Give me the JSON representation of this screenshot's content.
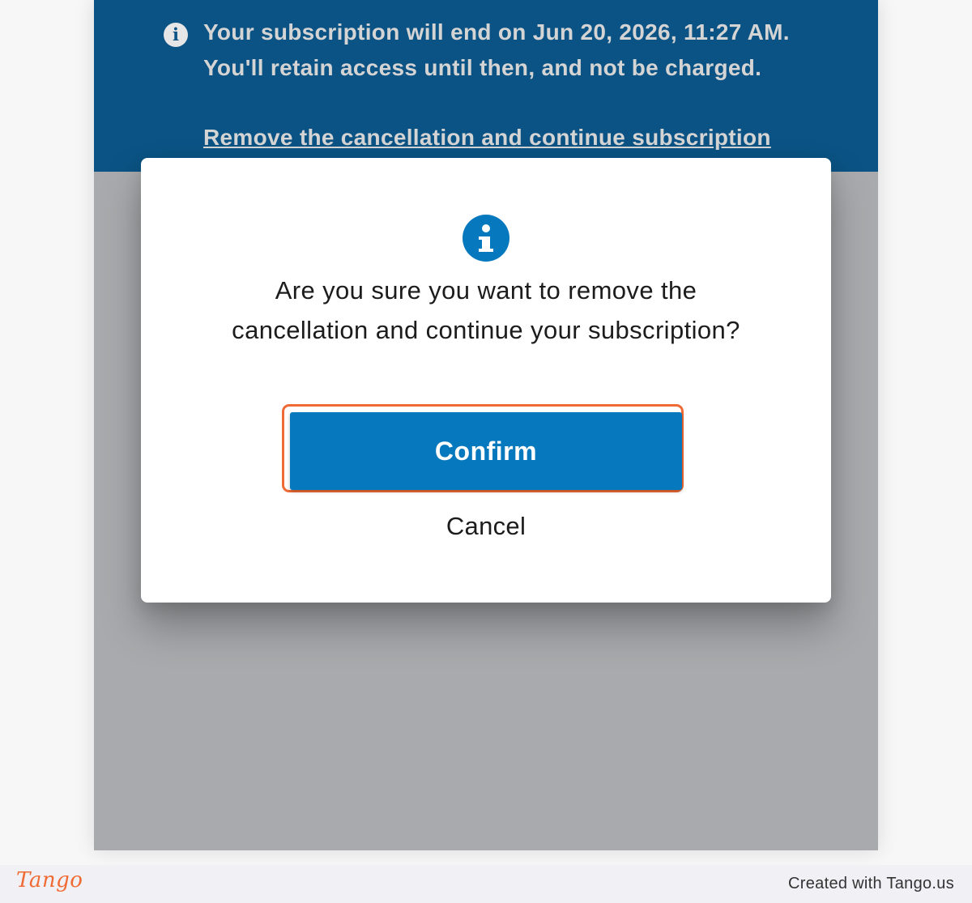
{
  "banner": {
    "icon": "info-icon",
    "message": "Your subscription will end on Jun 20, 2026, 11:27 AM. You'll retain access until then, and not be charged.",
    "link_label": "Remove the cancellation and continue subscription"
  },
  "modal": {
    "icon": "info-icon",
    "message": "Are you sure you want to remove the cancellation and continue your subscription?",
    "confirm_label": "Confirm",
    "cancel_label": "Cancel"
  },
  "footer": {
    "logo_text": "Tango",
    "created_with": "Created with Tango.us"
  },
  "colors": {
    "banner_bg": "#0b5384",
    "primary": "#0678bd",
    "highlight": "#f06a35",
    "overlay": "#a9aaad"
  }
}
